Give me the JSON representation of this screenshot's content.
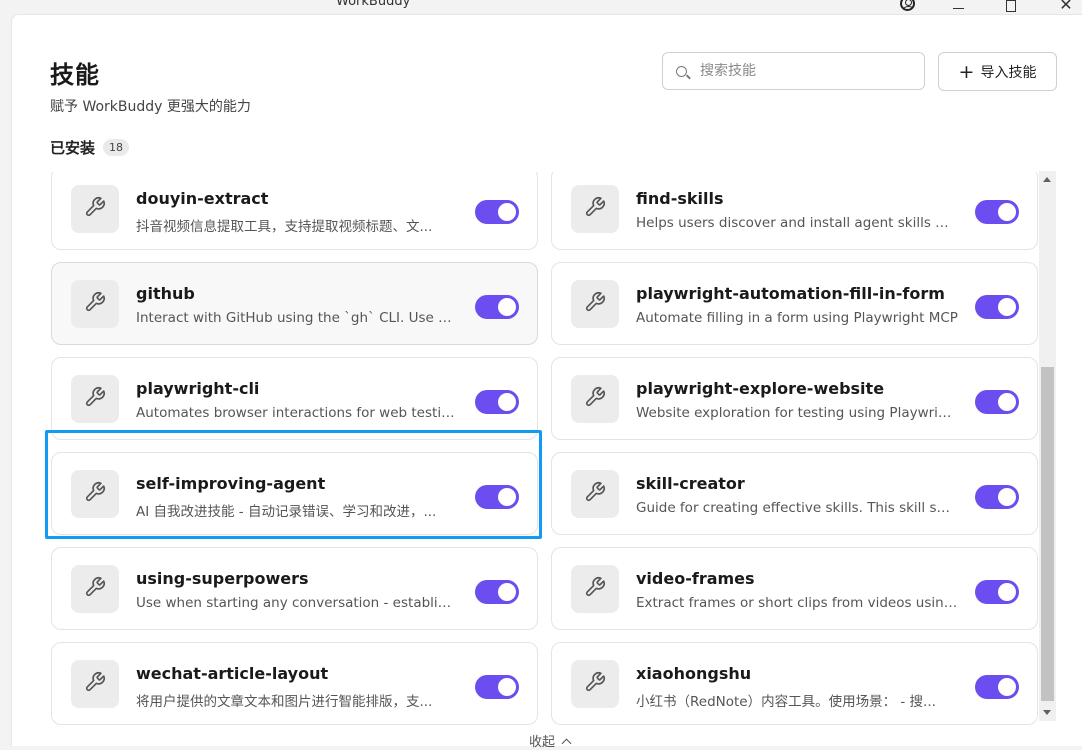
{
  "window": {
    "title": "WorkBuddy"
  },
  "header": {
    "title": "技能",
    "subtitle": "赋予 WorkBuddy 更强大的能力",
    "search_placeholder": "搜索技能",
    "import_label": "导入技能"
  },
  "installed": {
    "label": "已安装",
    "count": "18"
  },
  "colors": {
    "toggle_on": "#6b4df0",
    "highlight": "#129bf2"
  },
  "skills": [
    {
      "name": "douyin-extract",
      "desc": "抖音视频信息提取工具，支持提取视频标题、文...",
      "enabled": true,
      "icon": "wrench-icon"
    },
    {
      "name": "find-skills",
      "desc": "Helps users discover and install agent skills whe...",
      "enabled": true,
      "icon": "wrench-icon"
    },
    {
      "name": "github",
      "desc": "Interact with GitHub using the `gh` CLI. Use `gh ...",
      "enabled": true,
      "icon": "wrench-icon"
    },
    {
      "name": "playwright-automation-fill-in-form",
      "desc": "Automate filling in a form using Playwright MCP",
      "enabled": true,
      "icon": "wrench-icon"
    },
    {
      "name": "playwright-cli",
      "desc": "Automates browser interactions for web testing...",
      "enabled": true,
      "icon": "wrench-icon"
    },
    {
      "name": "playwright-explore-website",
      "desc": "Website exploration for testing using Playwrigh...",
      "enabled": true,
      "icon": "wrench-icon"
    },
    {
      "name": "self-improving-agent",
      "desc": "AI 自我改进技能 - 自动记录错误、学习和改进，...",
      "enabled": true,
      "icon": "wrench-icon"
    },
    {
      "name": "skill-creator",
      "desc": "Guide for creating effective skills. This skill shou...",
      "enabled": true,
      "icon": "wrench-icon"
    },
    {
      "name": "using-superpowers",
      "desc": "Use when starting any conversation - establishe...",
      "enabled": true,
      "icon": "wrench-icon"
    },
    {
      "name": "video-frames",
      "desc": "Extract frames or short clips from videos using f...",
      "enabled": true,
      "icon": "wrench-icon"
    },
    {
      "name": "wechat-article-layout",
      "desc": "将用户提供的文章文本和图片进行智能排版，支...",
      "enabled": true,
      "icon": "wrench-icon"
    },
    {
      "name": "xiaohongshu",
      "desc": "小红书（RedNote）内容工具。使用场景： - 搜...",
      "enabled": true,
      "icon": "wrench-icon"
    }
  ],
  "footer": {
    "collapse_label": "收起"
  }
}
